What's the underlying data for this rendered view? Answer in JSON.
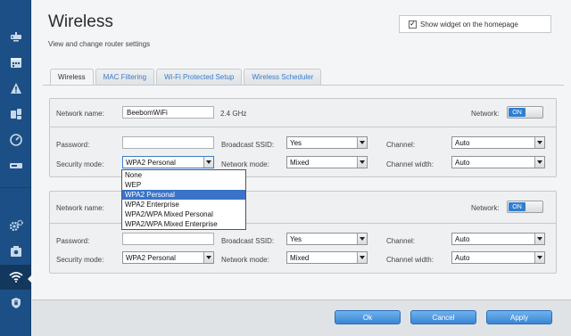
{
  "page": {
    "title": "Wireless",
    "subtitle": "View and change router settings"
  },
  "widget": {
    "checked": true,
    "check_glyph": "✓",
    "label": "Show widget on the homepage"
  },
  "sidebar": {
    "items": [
      {
        "icon": "network-map-icon"
      },
      {
        "icon": "calendar-icon"
      },
      {
        "icon": "warning-icon"
      },
      {
        "icon": "device-list-icon"
      },
      {
        "icon": "speed-gauge-icon"
      },
      {
        "icon": "usb-storage-icon"
      },
      {
        "icon": "connectivity-gear-icon"
      },
      {
        "icon": "router-settings-icon"
      },
      {
        "icon": "wifi-icon"
      },
      {
        "icon": "security-shield-icon"
      }
    ]
  },
  "tabs": [
    {
      "label": "Wireless",
      "active": true
    },
    {
      "label": "MAC Filtering",
      "active": false
    },
    {
      "label": "Wi-Fi Protected Setup",
      "active": false
    },
    {
      "label": "Wireless Scheduler",
      "active": false
    }
  ],
  "labels": {
    "network_name": "Network name:",
    "network": "Network:",
    "password": "Password:",
    "broadcast_ssid": "Broadcast SSID:",
    "channel": "Channel:",
    "security_mode": "Security mode:",
    "network_mode": "Network mode:",
    "channel_width": "Channel width:"
  },
  "panel_24": {
    "network_name": "BeebomWiFi",
    "band": "2.4 GHz",
    "network_toggle": "ON",
    "password": "",
    "broadcast_ssid": "Yes",
    "channel": "Auto",
    "security_mode": "WPA2 Personal",
    "network_mode": "Mixed",
    "channel_width": "Auto"
  },
  "panel_5": {
    "network_toggle": "ON",
    "password": "",
    "broadcast_ssid": "Yes",
    "channel": "Auto",
    "security_mode": "WPA2 Personal",
    "network_mode": "Mixed",
    "channel_width": "Auto"
  },
  "security_dropdown": {
    "options": [
      "None",
      "WEP",
      "WPA2 Personal",
      "WPA2 Enterprise",
      "WPA2/WPA Mixed Personal",
      "WPA2/WPA Mixed Enterprise"
    ],
    "selected": "WPA2 Personal"
  },
  "footer": {
    "ok": "Ok",
    "cancel": "Cancel",
    "apply": "Apply"
  },
  "colors": {
    "sidebar": "#1c4f86",
    "accent": "#2f7fd0",
    "tab_link": "#3b7cc9"
  }
}
